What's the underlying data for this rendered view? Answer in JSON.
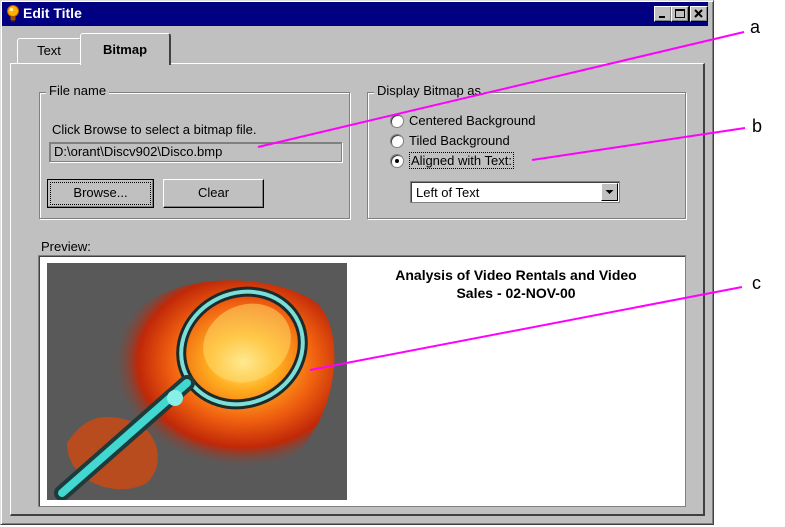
{
  "window": {
    "title": "Edit Title"
  },
  "tabs": [
    {
      "label": "Text",
      "selected": false
    },
    {
      "label": "Bitmap",
      "selected": true
    }
  ],
  "file_group": {
    "label": "File name",
    "hint": "Click Browse to select a bitmap file.",
    "path_value": "D:\\orant\\Discv902\\Disco.bmp",
    "browse_label": "Browse...",
    "clear_label": "Clear"
  },
  "display_group": {
    "label": "Display Bitmap as",
    "options": [
      {
        "label": "Centered Background",
        "selected": false
      },
      {
        "label": "Tiled Background",
        "selected": false
      },
      {
        "label": "Aligned with Text:",
        "selected": true
      }
    ],
    "alignment_value": "Left of Text"
  },
  "preview": {
    "label": "Preview:",
    "title_line1": "Analysis of Video Rentals and Video",
    "title_line2": "Sales  - 02-NOV-00"
  },
  "callouts": [
    "a",
    "b",
    "c"
  ],
  "colors": {
    "titlebar": "#000080",
    "dialog": "#c0c0c0",
    "callout_line": "#ff00ff"
  },
  "icons": {
    "app": "lightbulb-icon",
    "minimize": "minimize-icon",
    "maximize": "maximize-icon",
    "close": "close-icon",
    "dropdown": "chevron-down-icon",
    "preview_image": "magnifying-glass-image"
  }
}
